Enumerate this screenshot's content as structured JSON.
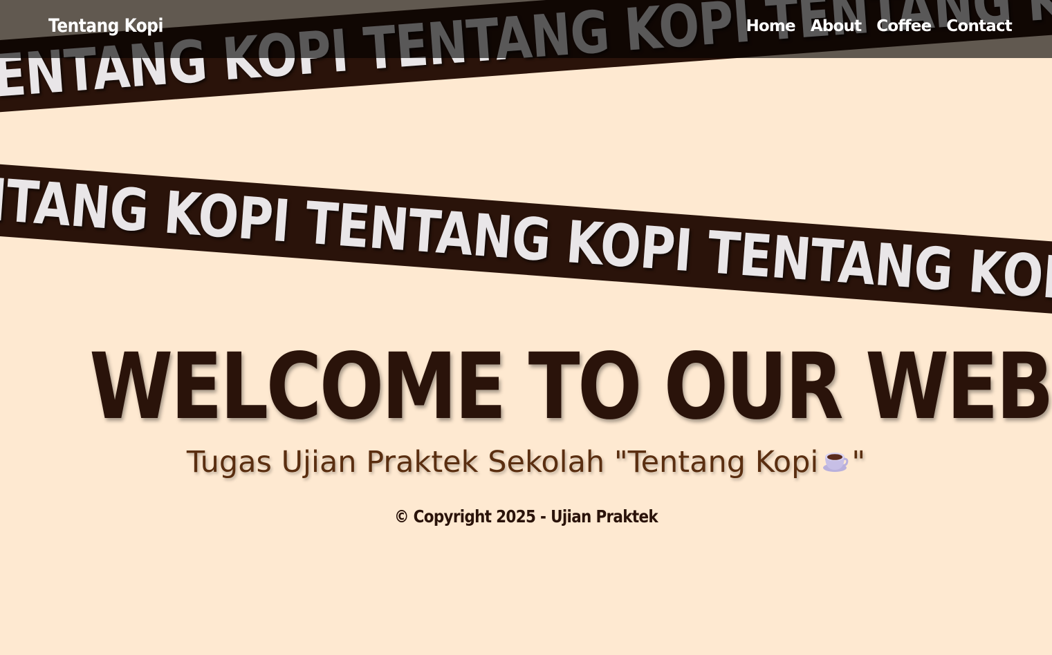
{
  "navbar": {
    "brand": "Tentang Kopi",
    "links": [
      "Home",
      "About",
      "Coffee",
      "Contact"
    ]
  },
  "ribbons": {
    "text": "TENTANG KOPI  TENTANG KOPI  TENTANG KOPI  TENTANG KOPI"
  },
  "hero": {
    "title": "WELCOME TO OUR WEBSITE",
    "subtitle_prefix": "Tugas Ujian Praktek Sekolah \"Tentang Kopi",
    "subtitle_suffix": "\"",
    "subtitle_icon": "coffee-cup-icon"
  },
  "footer": {
    "copyright": "© Copyright 2025 - Ujian Praktek"
  },
  "colors": {
    "background": "#fee9d1",
    "ribbon": "#2a130a",
    "ribbon_text": "#e9e6e8",
    "title": "#2a130a",
    "subtitle": "#5a2e10"
  }
}
